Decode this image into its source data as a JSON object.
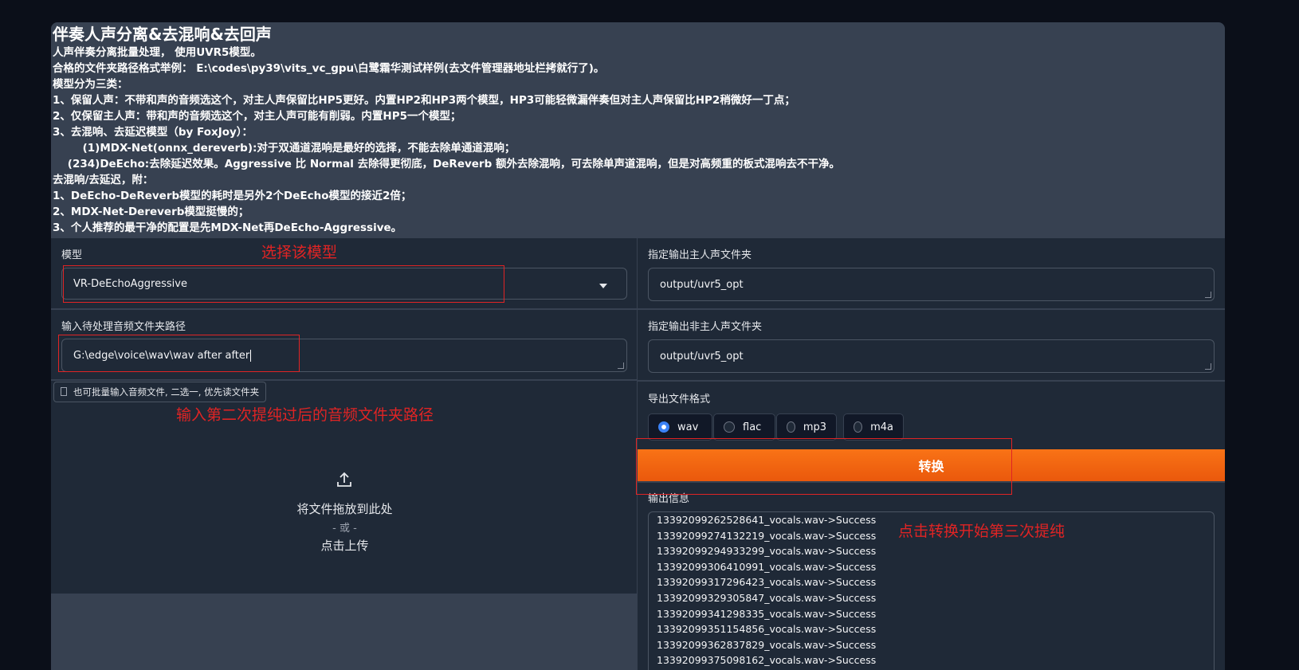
{
  "description": {
    "title": "伴奏人声分离&去混响&去回声",
    "lines": [
      "人声伴奏分离批量处理， 使用UVR5模型。",
      "合格的文件夹路径格式举例： E:\\codes\\py39\\vits_vc_gpu\\白鹭霜华测试样例(去文件管理器地址栏拷就行了)。",
      "模型分为三类：",
      "1、保留人声：不带和声的音频选这个，对主人声保留比HP5更好。内置HP2和HP3两个模型，HP3可能轻微漏伴奏但对主人声保留比HP2稍微好一丁点；",
      "2、仅保留主人声：带和声的音频选这个，对主人声可能有削弱。内置HP5一个模型；",
      "3、去混响、去延迟模型（by FoxJoy）：",
      "        (1)MDX-Net(onnx_dereverb):对于双通道混响是最好的选择，不能去除单通道混响；",
      "    (234)DeEcho:去除延迟效果。Aggressive 比 Normal 去除得更彻底，DeReverb 额外去除混响，可去除单声道混响，但是对高频重的板式混响去不干净。",
      "去混响/去延迟，附：",
      "1、DeEcho-DeReverb模型的耗时是另外2个DeEcho模型的接近2倍；",
      "2、MDX-Net-Dereverb模型挺慢的；",
      "3、个人推荐的最干净的配置是先MDX-Net再DeEcho-Aggressive。"
    ]
  },
  "model": {
    "label": "模型",
    "value": "VR-DeEchoAggressive"
  },
  "input_dir": {
    "label": "输入待处理音频文件夹路径",
    "value": "G:\\edge\\voice\\wav\\wav after after"
  },
  "upload": {
    "badge": "也可批量输入音频文件, 二选一, 优先读文件夹",
    "drop_text": "将文件拖放到此处",
    "or_text": "- 或 -",
    "click_text": "点击上传"
  },
  "output_vocal": {
    "label": "指定输出主人声文件夹",
    "value": "output/uvr5_opt"
  },
  "output_ins": {
    "label": "指定输出非主人声文件夹",
    "value": "output/uvr5_opt"
  },
  "format": {
    "label": "导出文件格式",
    "options": [
      "wav",
      "flac",
      "mp3",
      "m4a"
    ],
    "selected": "wav"
  },
  "convert_button": "转换",
  "output_info": {
    "label": "输出信息",
    "lines": [
      "13392099262528641_vocals.wav->Success",
      "13392099274132219_vocals.wav->Success",
      "13392099294933299_vocals.wav->Success",
      "13392099306410991_vocals.wav->Success",
      "13392099317296423_vocals.wav->Success",
      "13392099329305847_vocals.wav->Success",
      "13392099341298335_vocals.wav->Success",
      "13392099351154856_vocals.wav->Success",
      "13392099362837829_vocals.wav->Success",
      "13392099375098162_vocals.wav->Success"
    ]
  },
  "annotations": {
    "select_model": "选择该模型",
    "input_path": "输入第二次提纯过后的音频文件夹路径",
    "click_convert": "点击转换开始第三次提纯",
    "color": "#e02424"
  },
  "colors": {
    "accent": "#f97316",
    "panel": "#374151",
    "field": "#1f2937",
    "page_bg": "#0b0f19"
  }
}
